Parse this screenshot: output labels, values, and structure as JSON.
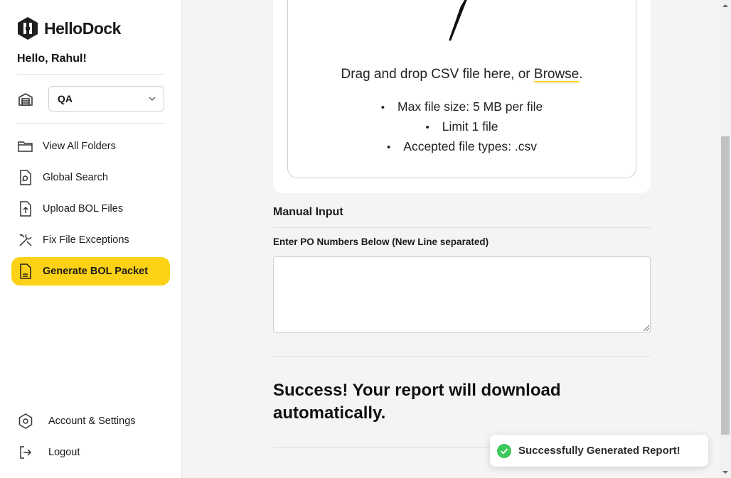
{
  "app": {
    "logo_text": "HelloDock",
    "accent_color": "#fcd116"
  },
  "sidebar": {
    "greeting": "Hello, Rahul!",
    "warehouse_select": {
      "value": "QA"
    },
    "nav_items": [
      {
        "label": "View All Folders",
        "icon": "folder-icon"
      },
      {
        "label": "Global Search",
        "icon": "search-file-icon"
      },
      {
        "label": "Upload BOL Files",
        "icon": "upload-file-icon"
      },
      {
        "label": "Fix File Exceptions",
        "icon": "tools-icon"
      },
      {
        "label": "Generate BOL Packet",
        "icon": "document-icon",
        "active": true
      }
    ],
    "bottom_items": [
      {
        "label": "Account & Settings",
        "icon": "settings-icon"
      },
      {
        "label": "Logout",
        "icon": "logout-icon"
      }
    ]
  },
  "upload": {
    "drop_text": "Drag and drop CSV file here, or ",
    "browse_label": "Browse",
    "drop_suffix": ".",
    "rules": [
      "Max file size: 5 MB per file",
      "Limit 1 file",
      "Accepted file types: .csv"
    ]
  },
  "manual_input": {
    "title": "Manual Input",
    "field_label": "Enter PO Numbers Below (New Line separated)",
    "value": ""
  },
  "status": {
    "message": "Success! Your report will download automatically."
  },
  "toast": {
    "message": "Successfully Generated Report!",
    "status_color": "#3cc85a"
  }
}
